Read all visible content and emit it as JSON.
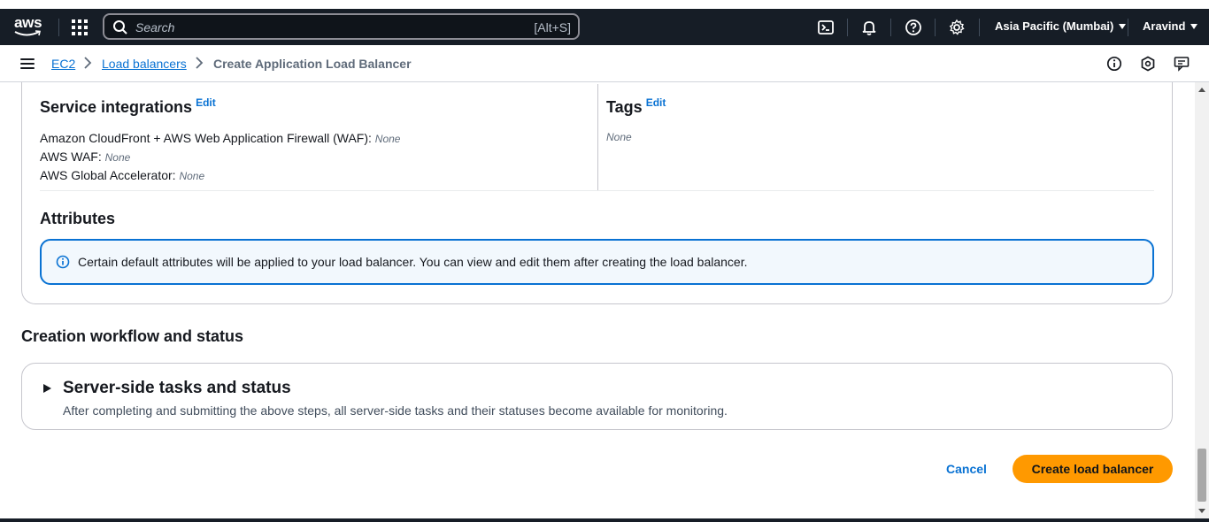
{
  "topnav": {
    "logo_text": "aws",
    "search_placeholder": "Search",
    "search_shortcut": "[Alt+S]",
    "region": "Asia Pacific (Mumbai)",
    "user": "Aravind",
    "icons": [
      "services-grid-icon",
      "cloudshell-icon",
      "bell-icon",
      "help-icon",
      "gear-icon"
    ]
  },
  "breadcrumb": {
    "items": [
      "EC2",
      "Load balancers"
    ],
    "current": "Create Application Load Balancer"
  },
  "service_integrations": {
    "heading": "Service integrations",
    "edit": "Edit",
    "rows": [
      {
        "label": "Amazon CloudFront + AWS Web Application Firewall (WAF):",
        "value": "None"
      },
      {
        "label": "AWS WAF:",
        "value": "None"
      },
      {
        "label": "AWS Global Accelerator:",
        "value": "None"
      }
    ]
  },
  "tags": {
    "heading": "Tags",
    "edit": "Edit",
    "value": "None"
  },
  "attributes": {
    "heading": "Attributes",
    "info": "Certain default attributes will be applied to your load balancer. You can view and edit them after creating the load balancer."
  },
  "workflow": {
    "heading": "Creation workflow and status",
    "expander_title": "Server-side tasks and status",
    "expander_desc": "After completing and submitting the above steps, all server-side tasks and their statuses become available for monitoring."
  },
  "actions": {
    "cancel": "Cancel",
    "create": "Create load balancer"
  },
  "colors": {
    "nav_bg": "#161d26",
    "link": "#0972d3",
    "primary_button": "#ff9900",
    "info_border": "#0972d3"
  }
}
